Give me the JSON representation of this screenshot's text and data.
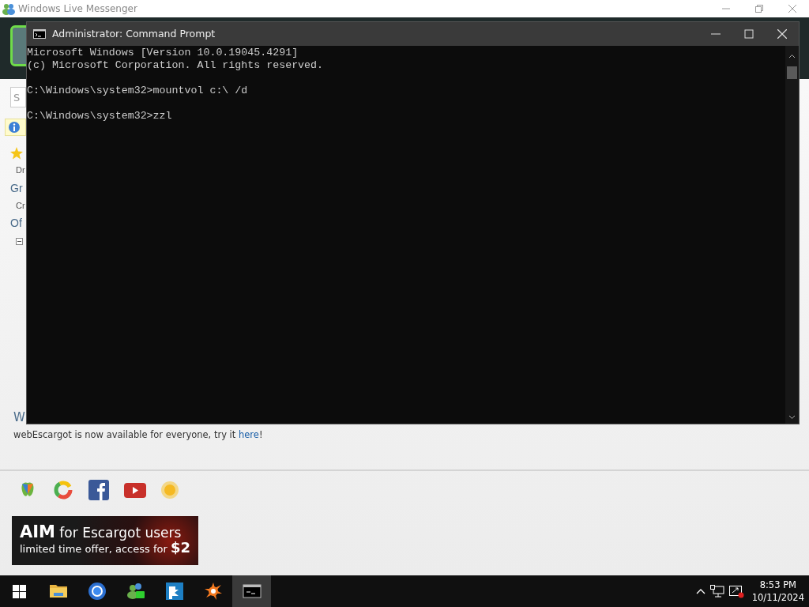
{
  "messenger_window": {
    "title": "Windows Live Messenger",
    "search_placeholder": "S",
    "list_items": [
      {
        "kind": "favorite",
        "text": "Dr"
      },
      {
        "kind": "heading",
        "text": "Gr"
      },
      {
        "kind": "item",
        "text": "Cr"
      },
      {
        "kind": "heading",
        "text": "Of"
      },
      {
        "kind": "collapse"
      }
    ],
    "news_heading": "W",
    "news_text": "webEscargot is now available for everyone, try it ",
    "news_link": "here",
    "news_end": "!",
    "services": [
      {
        "kind": "msn"
      },
      {
        "kind": "ring"
      },
      {
        "kind": "facebook"
      },
      {
        "kind": "video"
      },
      {
        "kind": "sun"
      }
    ],
    "banner": {
      "line1": "**AIM** for Escargot users",
      "line2": "limited time offer, access for **$2**"
    }
  },
  "console_window": {
    "title": "Administrator: Command Prompt",
    "blocks": [
      [
        "Microsoft Windows [Version 10.0.19045.4291]",
        "(c) Microsoft Corporation. All rights reserved."
      ],
      [
        "C:\\Windows\\system32>mountvol c:\\ /d"
      ],
      [
        "C:\\Windows\\system32>zzl"
      ]
    ]
  },
  "taskbar": {
    "apps": [
      {
        "kind": "folder",
        "active": false
      },
      {
        "kind": "browser",
        "active": false
      },
      {
        "kind": "messenger",
        "active": false
      },
      {
        "kind": "arrow",
        "active": false
      },
      {
        "kind": "antivirus",
        "active": false
      },
      {
        "kind": "console",
        "active": true
      }
    ],
    "clock": {
      "time": "8:53 PM",
      "date": "10/11/2024"
    }
  }
}
